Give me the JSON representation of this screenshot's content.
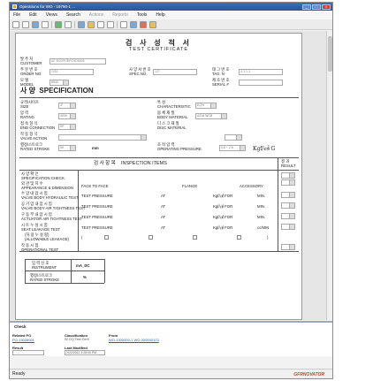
{
  "window": {
    "title": "Operations for WO - 19790-1 ...",
    "brand_color": "#2f5fa6"
  },
  "menu": [
    "File",
    "Edit",
    "Views",
    "Search",
    "Actions",
    "Reports",
    "Tools",
    "Help"
  ],
  "menu_disabled": [
    "Actions",
    "Reports"
  ],
  "document": {
    "title_kr": "검 사 성 적 서",
    "title_en": "TEST  CERTIFICATE",
    "customer": {
      "kr": "발 주 처",
      "en": "CUSTOMER",
      "value": "AE BI20PHRRC5D6606"
    },
    "order_no": {
      "kr": "주 문 번 호",
      "en": "ORDER  NO.",
      "value": "1001"
    },
    "spec_no": {
      "kr": "사 양 서 번 호",
      "en": "SPEC  NO.",
      "value": "127"
    },
    "tag_no": {
      "kr": "태 그 번 호",
      "en": "TAG. N",
      "value": "4-1 1-1"
    },
    "model": {
      "kr": "모 델",
      "en": "MODEL",
      "value": "8530"
    },
    "serial": {
      "kr": "제 조 번 호",
      "en": "SERIAL  #",
      "value": ""
    },
    "spec_header": {
      "kr": "사 양",
      "en": "SPECIFICATION"
    },
    "size": {
      "kr": "규격/사이즈",
      "en": "SIZE",
      "value": "4\""
    },
    "characteristic": {
      "kr": "특 성",
      "en": "CHARACTERISTIC",
      "value": "EQ%"
    },
    "rating": {
      "kr": "압 력",
      "en": "RATING",
      "value": "300#"
    },
    "body_material": {
      "kr": "몸 체 재 질",
      "en": "BODY  MATERIAL",
      "value": "A216 WCB"
    },
    "end_connection": {
      "kr": "접 속 형 식",
      "en": "END  CONNECTION",
      "value": "RF"
    },
    "disc_material": {
      "kr": "디 스 크 재 질",
      "en": "DISC  MATERIAL",
      "value": ""
    },
    "valve_action": {
      "kr": "작 동 형 식",
      "en": "VALVE  ACTION",
      "value": ""
    },
    "rated_stroke": {
      "kr": "행정/스트로크",
      "en": "RATED  STROKE",
      "value": "60",
      "unit": "mm"
    },
    "operating_pressure": {
      "kr": "조 작 압 력",
      "en": "OPERATING  PRESSURE",
      "value": "0.8 ~ 2.6",
      "unit": "Kgf/㎠ G"
    },
    "inspection_header": {
      "kr": "검  사  항  목",
      "en": "INSPECTION  ITEMS",
      "result_kr": "결 과",
      "result_en": "RESULT"
    },
    "rows": [
      {
        "kr": "사 양 확 인",
        "en": "SPECIFICATION  CHECK",
        "mid": ""
      },
      {
        "kr": "외 관 및 치 수",
        "en": "APPEARANCE  &  DIMENSION",
        "mid": "FACE  TO  FACE",
        "mid2": "FLANGE",
        "right": "ACCESSORY"
      },
      {
        "kr": "수 압 내 압 시 험",
        "en": "VALVE  BODY  HYDRAULIC  TEST",
        "mid": "TEST PRESSURE",
        "at": "AT",
        "unit": "Kgf/㎠  FOR",
        "min": "MIN."
      },
      {
        "kr": "공 기 압 내 압 시 험",
        "en": "VALVE  BODY  AIR  TIGHTNESS  TEST",
        "mid": "TEST PRESSURE",
        "at": "AT",
        "unit": "Kgf/㎠  FOR",
        "min": "MIN."
      },
      {
        "kr": "구 동 부 내 압 시 험",
        "en": "ACTUATOR  AIR  TIGHTNESS  TEST",
        "mid": "TEST PRESSURE",
        "at": "AT",
        "unit": "Kgf/㎠  FOR",
        "min": "MIN."
      },
      {
        "kr": "시 트 누 설 시 험",
        "en": "SEAT   LEAKAGE   TEST",
        "mid": "TEST PRESSURE",
        "at": "AT",
        "unit": "Kgf/㎠  FOR",
        "min": "cc/MIN"
      },
      {
        "kr": "(허 용 누 설 량)",
        "en": "(ALLOWABLE  LEAKAGE)",
        "mid": "",
        "paren_open": "(",
        "paren_close": ")"
      },
      {
        "kr": "작 동 시 험",
        "en": "OPERATIONAL   TEST",
        "mid": ""
      }
    ],
    "bottom_table": [
      {
        "kr": "입 력 신 호",
        "en": "INSTRUMENT",
        "value": "mA_DC"
      },
      {
        "kr": "행정/스트로크",
        "en": "RATED  STROKE",
        "value": "%"
      }
    ]
  },
  "check_panel": {
    "tab": "Check",
    "related_po_label": "Related PO",
    "related_po_value": "PO-13026001",
    "classification_label": "Classification",
    "classification_value": "W-OQ Test Certi",
    "from_label": "From",
    "from_value": "WO-1300000-1 WO-000000123",
    "result_label": "Result",
    "last_modified_label": "Last Modified",
    "last_modified_value": "2/22/2011 3:28:00 PM"
  },
  "status": {
    "text": "Ready",
    "logo": "GFRNOVATOR"
  }
}
